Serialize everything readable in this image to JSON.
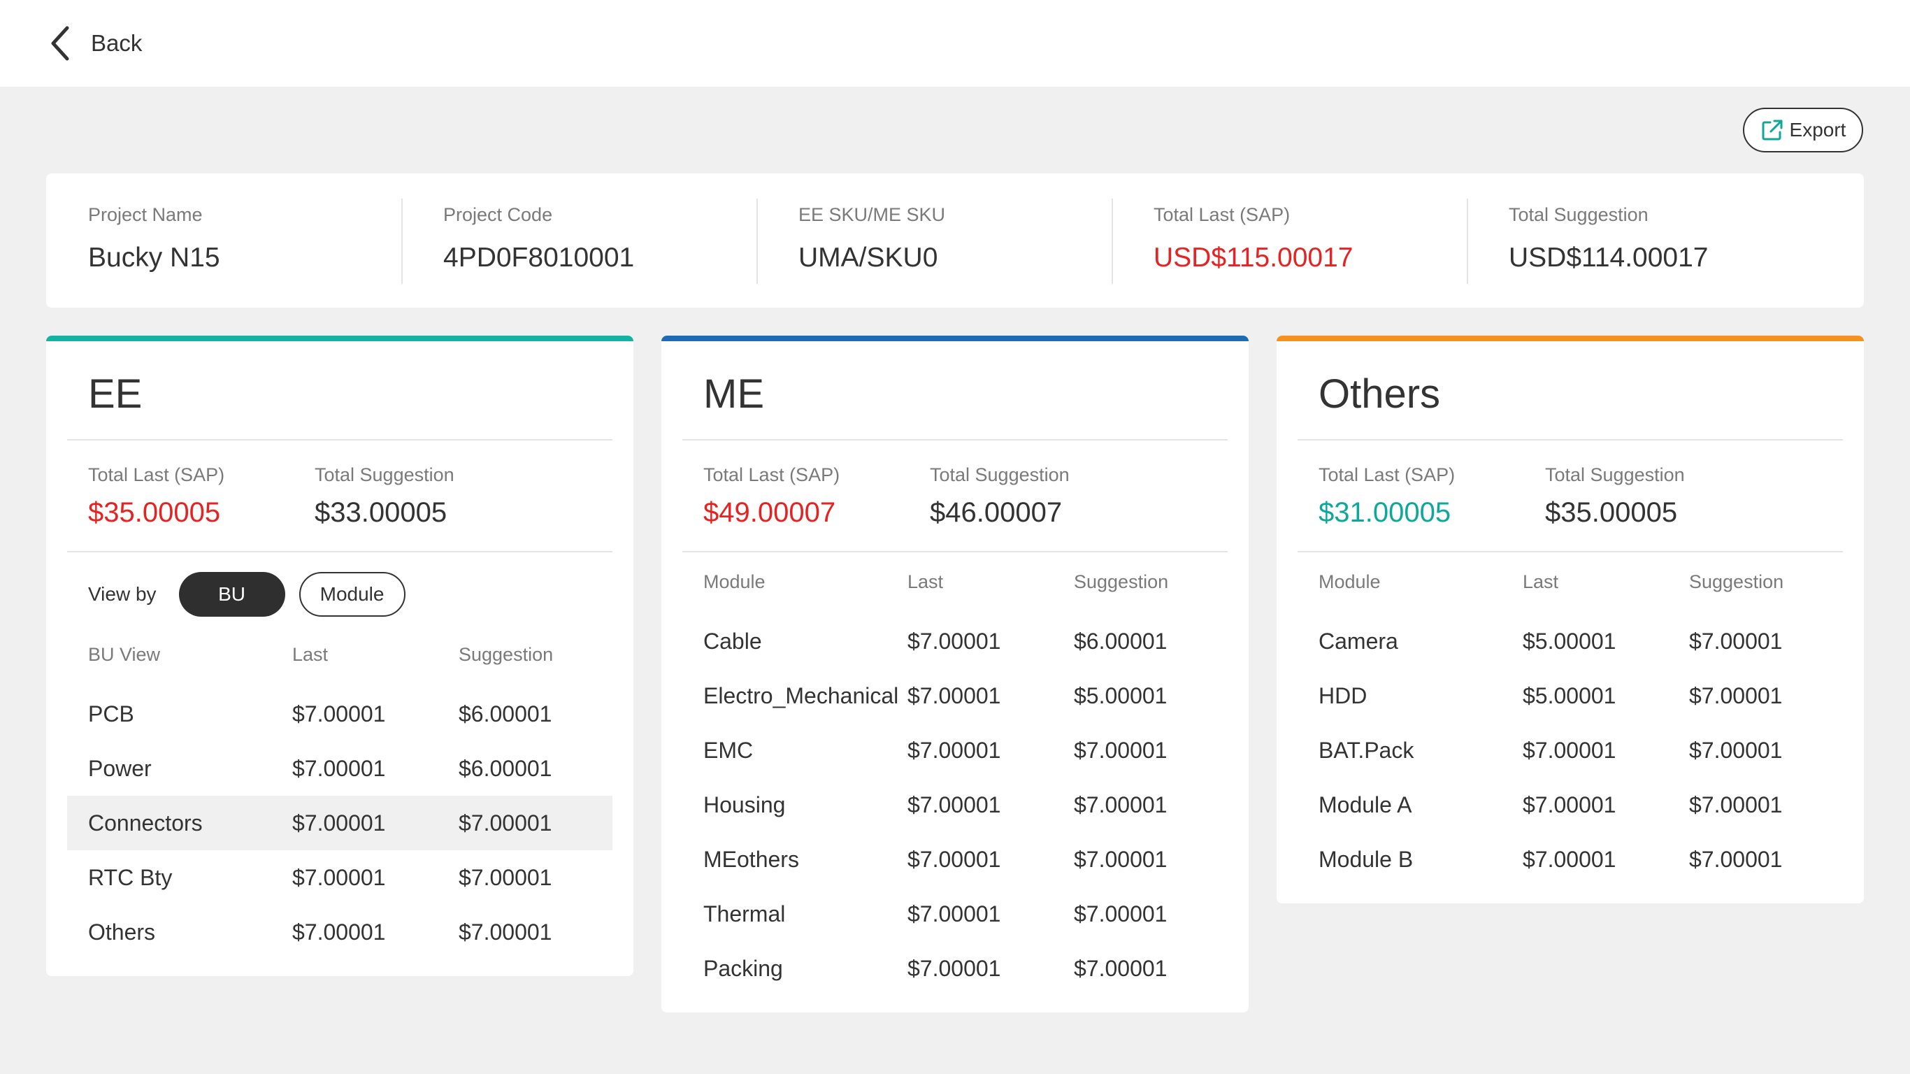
{
  "header": {
    "back_label": "Back"
  },
  "toolbar": {
    "export_label": "Export"
  },
  "summary": [
    {
      "label": "Project Name",
      "value": "Bucky N15"
    },
    {
      "label": "Project Code",
      "value": "4PD0F8010001"
    },
    {
      "label": "EE SKU/ME SKU",
      "value": "UMA/SKU0"
    },
    {
      "label": "Total Last (SAP)",
      "value": "USD$115.00017"
    },
    {
      "label": "Total Suggestion",
      "value": "USD$114.00017"
    }
  ],
  "colors": {
    "ee_accent": "#13b3a3",
    "me_accent": "#1b6bb5",
    "others_accent": "#f5921e",
    "red_value": "#e52323",
    "teal_value": "#0ea89a"
  },
  "ee": {
    "title": "EE",
    "total_last_label": "Total Last (SAP)",
    "total_last_value": "$35.00005",
    "total_suggestion_label": "Total Suggestion",
    "total_suggestion_value": "$33.00005",
    "view_by_label": "View by",
    "view_by_options": [
      "BU",
      "Module"
    ],
    "columns": [
      "BU View",
      "Last",
      "Suggestion"
    ],
    "rows": [
      [
        "PCB",
        "$7.00001",
        "$6.00001"
      ],
      [
        "Power",
        "$7.00001",
        "$6.00001"
      ],
      [
        "Connectors",
        "$7.00001",
        "$7.00001"
      ],
      [
        "RTC Bty",
        "$7.00001",
        "$7.00001"
      ],
      [
        "Others",
        "$7.00001",
        "$7.00001"
      ]
    ]
  },
  "me": {
    "title": "ME",
    "total_last_label": "Total Last (SAP)",
    "total_last_value": "$49.00007",
    "total_suggestion_label": "Total Suggestion",
    "total_suggestion_value": "$46.00007",
    "columns": [
      "Module",
      "Last",
      "Suggestion"
    ],
    "rows": [
      [
        "Cable",
        "$7.00001",
        "$6.00001"
      ],
      [
        "Electro_Mechanical",
        "$7.00001",
        "$5.00001"
      ],
      [
        "EMC",
        "$7.00001",
        "$7.00001"
      ],
      [
        "Housing",
        "$7.00001",
        "$7.00001"
      ],
      [
        "MEothers",
        "$7.00001",
        "$7.00001"
      ],
      [
        "Thermal",
        "$7.00001",
        "$7.00001"
      ],
      [
        "Packing",
        "$7.00001",
        "$7.00001"
      ]
    ]
  },
  "others": {
    "title": "Others",
    "total_last_label": "Total Last (SAP)",
    "total_last_value": "$31.00005",
    "total_suggestion_label": "Total Suggestion",
    "total_suggestion_value": "$35.00005",
    "columns": [
      "Module",
      "Last",
      "Suggestion"
    ],
    "rows": [
      [
        "Camera",
        "$5.00001",
        "$7.00001"
      ],
      [
        "HDD",
        "$5.00001",
        "$7.00001"
      ],
      [
        "BAT.Pack",
        "$7.00001",
        "$7.00001"
      ],
      [
        "Module A",
        "$7.00001",
        "$7.00001"
      ],
      [
        "Module B",
        "$7.00001",
        "$7.00001"
      ]
    ]
  }
}
